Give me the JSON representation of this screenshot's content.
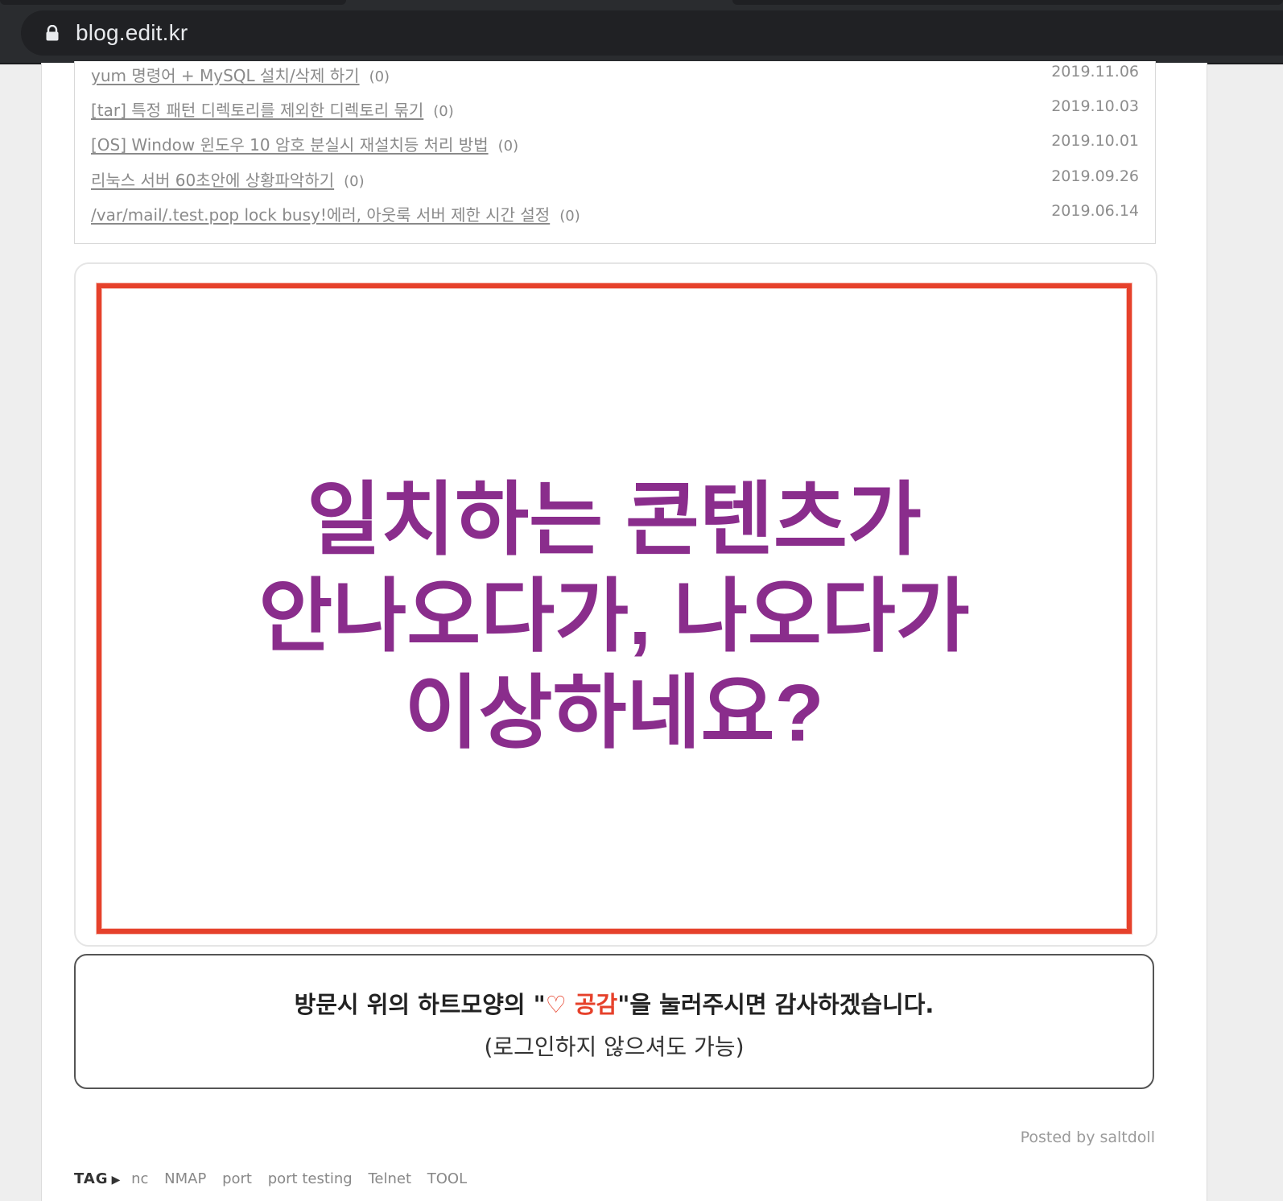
{
  "browser": {
    "url": "blog.edit.kr"
  },
  "related_posts": [
    {
      "title": "yum 명령어 + MySQL 설치/삭제 하기",
      "count": "(0)",
      "date": "2019.11.06"
    },
    {
      "title": "[tar] 특정 패턴 디렉토리를 제외한 디렉토리 묶기",
      "count": "(0)",
      "date": "2019.10.03"
    },
    {
      "title": "[OS] Window 윈도우 10 암호 분실시 재설치등 처리 방법",
      "count": "(0)",
      "date": "2019.10.01"
    },
    {
      "title": "리눅스 서버 60초안에 상황파악하기",
      "count": "(0)",
      "date": "2019.09.26"
    },
    {
      "title": "/var/mail/.test.pop lock busy!에러, 아웃룩 서버 제한 시간 설정",
      "count": "(0)",
      "date": "2019.06.14"
    }
  ],
  "ad": {
    "line1": "일치하는 콘텐츠가",
    "line2": "안나오다가, 나오다가",
    "line3": "이상하네요?",
    "text_color": "#8a2d8c",
    "border_color": "#e6412b"
  },
  "notice": {
    "line1_prefix": "방문시 위의 하트모양의 \"",
    "heart_symbol": "♡",
    "like_word": "공감",
    "line1_suffix": "\"을 눌러주시면 감사하겠습니다.",
    "line2": "(로그인하지 않으셔도 가능)"
  },
  "posted_by": "Posted by saltdoll",
  "tags": {
    "label": "TAG",
    "items": [
      "nc",
      "NMAP",
      "port",
      "port testing",
      "Telnet",
      "TOOL"
    ]
  }
}
